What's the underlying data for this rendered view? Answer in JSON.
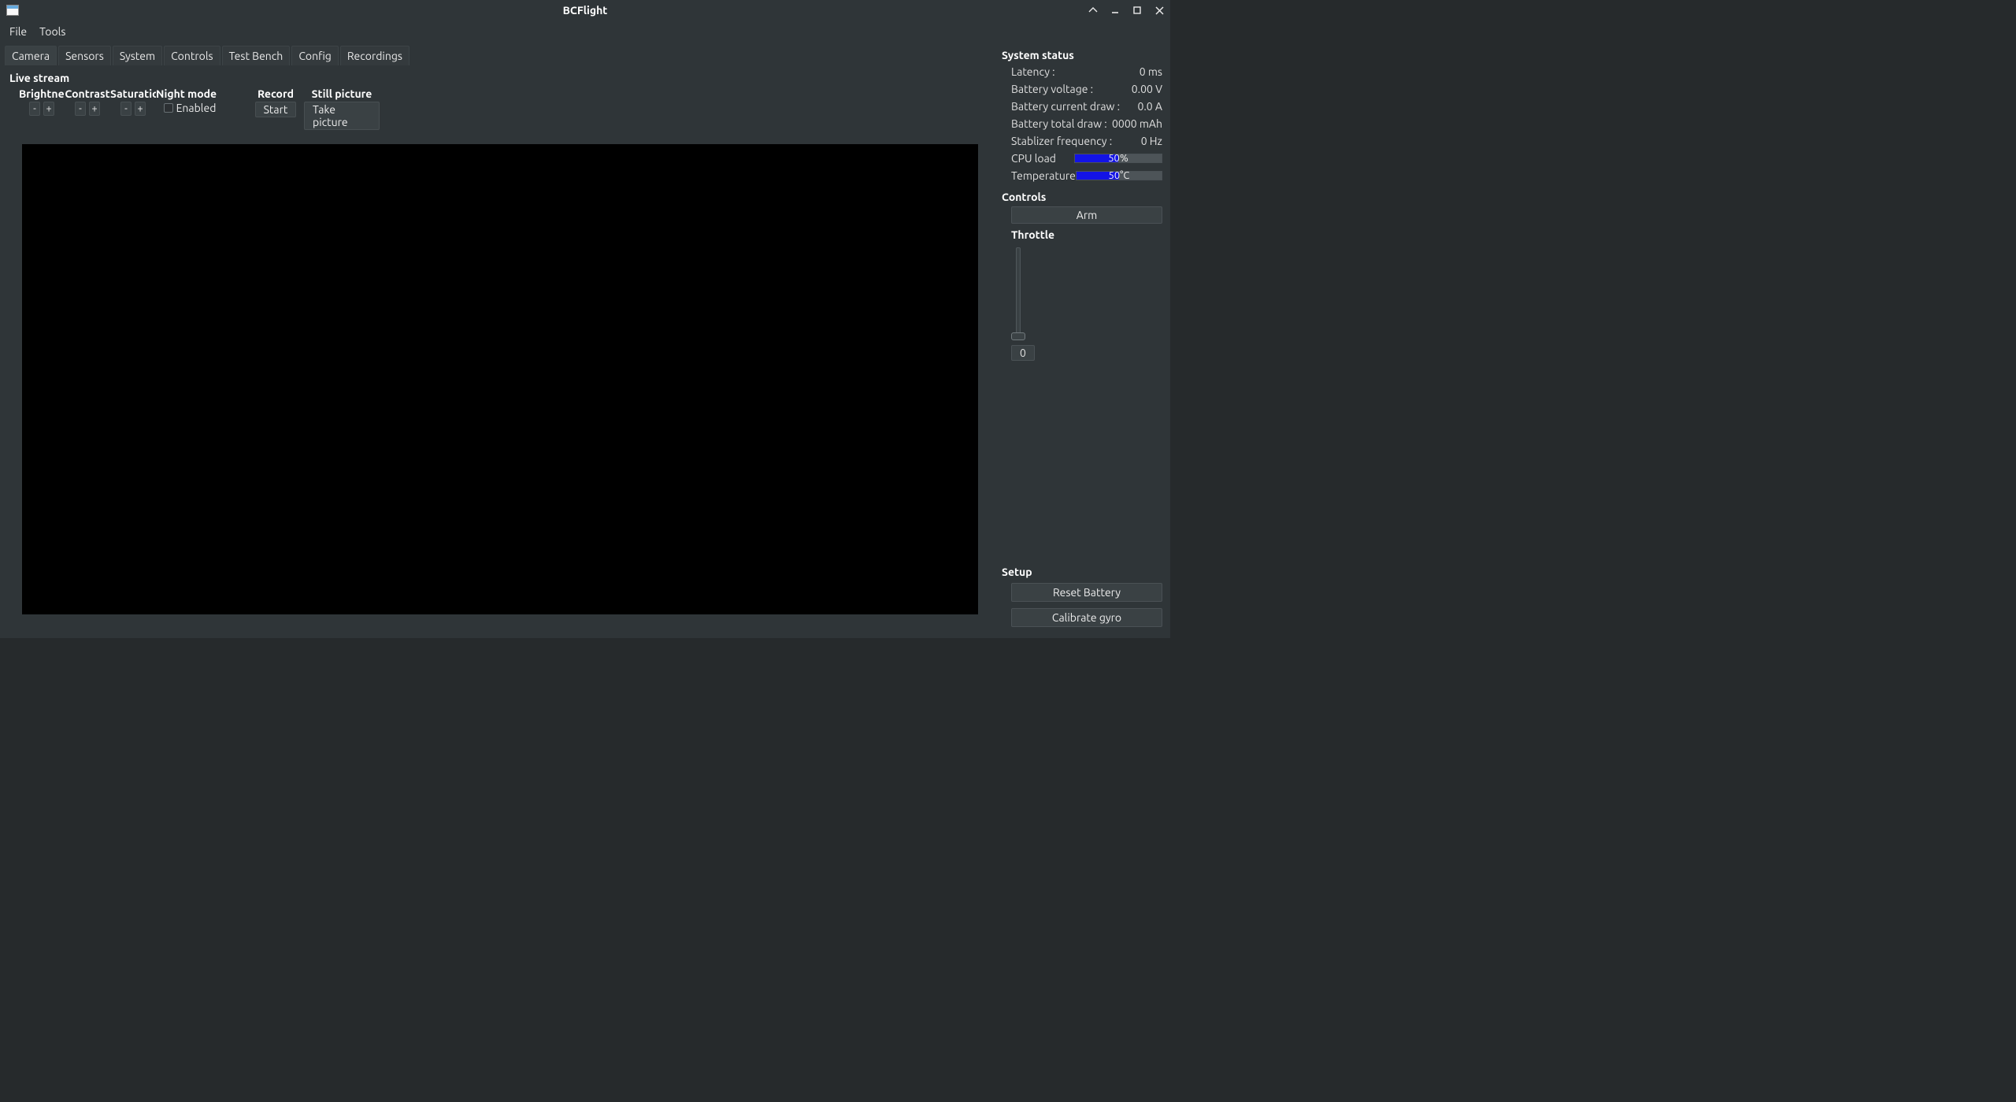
{
  "window": {
    "title": "BCFlight"
  },
  "menu": {
    "file": "File",
    "tools": "Tools"
  },
  "tabs": [
    "Camera",
    "Sensors",
    "System",
    "Controls",
    "Test Bench",
    "Config",
    "Recordings"
  ],
  "activeTab": 0,
  "camera": {
    "section_title": "Live stream",
    "brightness_label": "Brightness",
    "contrast_label": "Contrast",
    "saturation_label": "Saturation",
    "night_mode_label": "Night mode",
    "night_mode_checkbox": "Enabled",
    "record_label": "Record",
    "record_button": "Start",
    "still_label": "Still picture",
    "still_button": "Take picture",
    "minus": "-",
    "plus": "+"
  },
  "status": {
    "heading": "System status",
    "latency_label": "Latency :",
    "latency_value": "0 ms",
    "battery_voltage_label": "Battery voltage :",
    "battery_voltage_value": "0.00 V",
    "battery_current_label": "Battery current draw :",
    "battery_current_value": "0.0 A",
    "battery_total_label": "Battery total draw :",
    "battery_total_value": "0000 mAh",
    "stabilizer_label": "Stablizer frequency :",
    "stabilizer_value": "0 Hz",
    "cpu_label": "CPU load",
    "cpu_text": "50%",
    "temp_label": "Temperature",
    "temp_text": "50°C"
  },
  "controls": {
    "heading": "Controls",
    "arm_button": "Arm",
    "throttle_label": "Throttle",
    "throttle_value": "0"
  },
  "setup": {
    "heading": "Setup",
    "reset_battery": "Reset Battery",
    "calibrate_gyro": "Calibrate gyro"
  }
}
